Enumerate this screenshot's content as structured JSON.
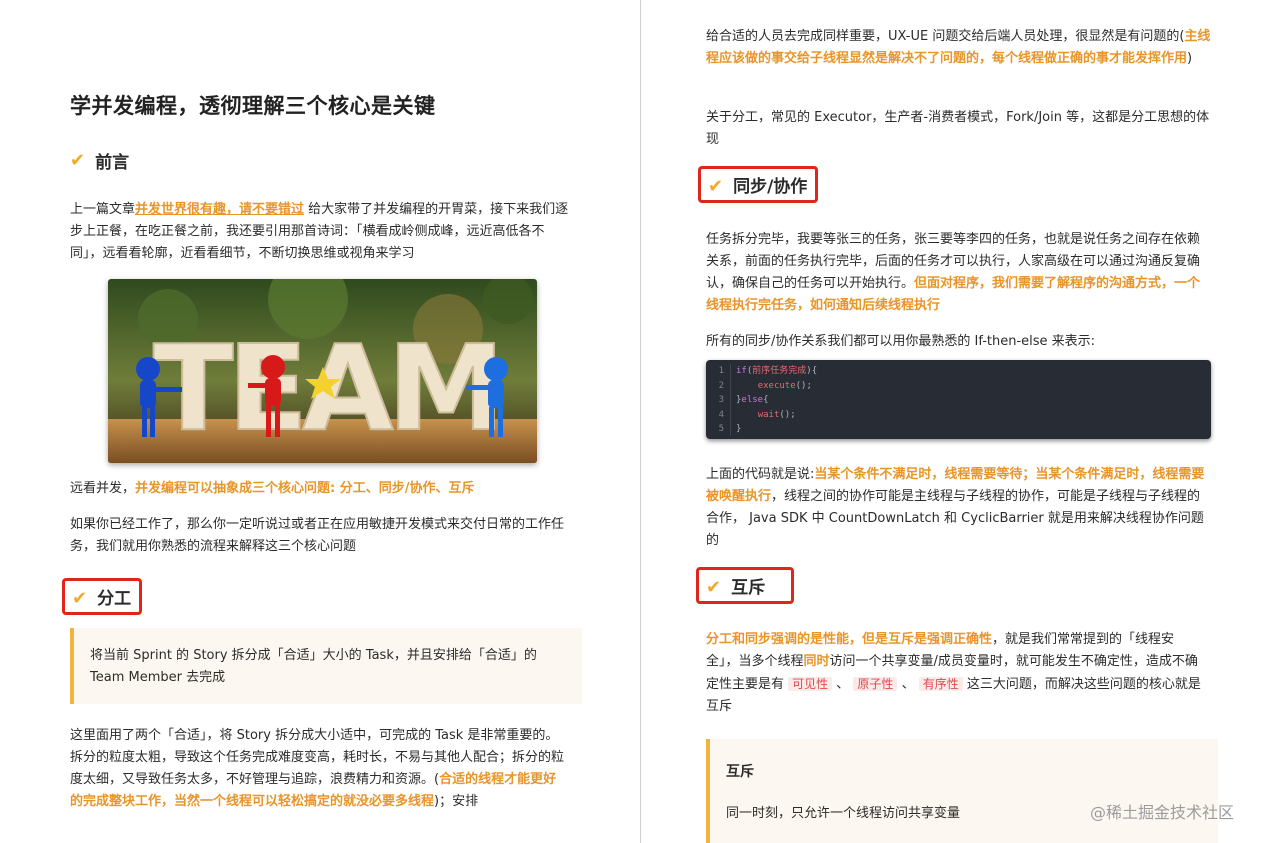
{
  "title": "学并发编程，透彻理解三个核心是关键",
  "check_icon": "✔",
  "sections": {
    "preface": "前言",
    "division": "分工",
    "sync": "同步/协作",
    "mutex": "互斥"
  },
  "left": {
    "p1_a": "上一篇文章",
    "p1_link": "并发世界很有趣，请不要错过",
    "p1_b": " 给大家带了并发编程的开胃菜，接下来我们逐步上正餐，在吃正餐之前，我还要引用那首诗词：「横看成岭侧成峰，远近高低各不同」，远看看轮廓，近看看细节，不断切换思维或视角来学习",
    "photo_text": "TEAM",
    "p2_a": "远看并发，",
    "p2_hl": "并发编程可以抽象成三个核心问题: 分工、同步/协作、互斥",
    "p3": "如果你已经工作了，那么你一定听说过或者正在应用敏捷开发模式来交付日常的工作任务，我们就用你熟悉的流程来解释这三个核心问题",
    "quote": "将当前 Sprint 的 Story 拆分成「合适」大小的 Task，并且安排给「合适」的 Team Member 去完成",
    "p4_a": "这里面用了两个「合适」，将 Story 拆分成大小适中，可完成的 Task 是非常重要的。拆分的粒度太粗，导致这个任务完成难度变高，耗时长，不易与其他人配合；拆分的粒度太细，又导致任务太多，不好管理与追踪，浪费精力和资源。(",
    "p4_hl": "合适的线程才能更好的完成整块工作，当然一个线程可以轻松搞定的就没必要多线程",
    "p4_b": ")；安排"
  },
  "right": {
    "r1_a": "给合适的人员去完成同样重要，UX-UE 问题交给后端人员处理，很显然是有问题的(",
    "r1_hl": "主线程应该做的事交给子线程显然是解决不了问题的，每个线程做正确的事才能发挥作用",
    "r1_b": ")",
    "r2": "关于分工，常见的 Executor，生产者-消费者模式，Fork/Join 等，这都是分工思想的体现",
    "r3_a": "任务拆分完毕，我要等张三的任务，张三要等李四的任务，也就是说任务之间存在依赖关系，前面的任务执行完毕，后面的任务才可以执行，人家高级在可以通过沟通反复确认，确保自己的任务可以开始执行。",
    "r3_hl": "但面对程序，我们需要了解程序的沟通方式，一个线程执行完任务，如何通知后续线程执行",
    "r4": "所有的同步/协作关系我们都可以用你最熟悉的 If-then-else 来表示:",
    "code_lines": [
      "1",
      "2",
      "3",
      "4",
      "5"
    ],
    "code": {
      "if_kw": "if",
      "if_open": "(",
      "cond": "前序任务完成",
      "if_close": "){",
      "exec": "execute",
      "exec_tail": "();",
      "else_a": "}",
      "else_kw": "else",
      "else_b": "{",
      "wait": "wait",
      "wait_tail": "();",
      "close": "}"
    },
    "r5_a": "上面的代码就是说:",
    "r5_hl": "当某个条件不满足时，线程需要等待；当某个条件满足时，线程需要被唤醒执行",
    "r5_b": "，线程之间的协作可能是主线程与子线程的协作，可能是子线程与子线程的合作， Java SDK 中 CountDownLatch 和 CyclicBarrier 就是用来解决线程协作问题的",
    "r6_hl": "分工和同步强调的是性能，但是互斥是强调正确性",
    "r6_a": "，就是我们常常提到的「线程安全」，当多个线程",
    "r6_hl2": "同时",
    "r6_b": "访问一个共享变量/成员变量时，就可能发生不确定性，造成不确定性主要是有 ",
    "tag1": "可见性",
    "sep1": " 、 ",
    "tag2": "原子性",
    "sep2": " 、 ",
    "tag3": "有序性",
    "r6_c": " 这三大问题，而解决这些问题的核心就是互斥",
    "quote_title": "互斥",
    "quote_body": "同一时刻，只允许一个线程访问共享变量"
  },
  "watermark": "@稀土掘金技术社区",
  "colors": {
    "accent": "#e8952a",
    "redbox": "#e0261c",
    "quote_bar": "#f2b441"
  }
}
